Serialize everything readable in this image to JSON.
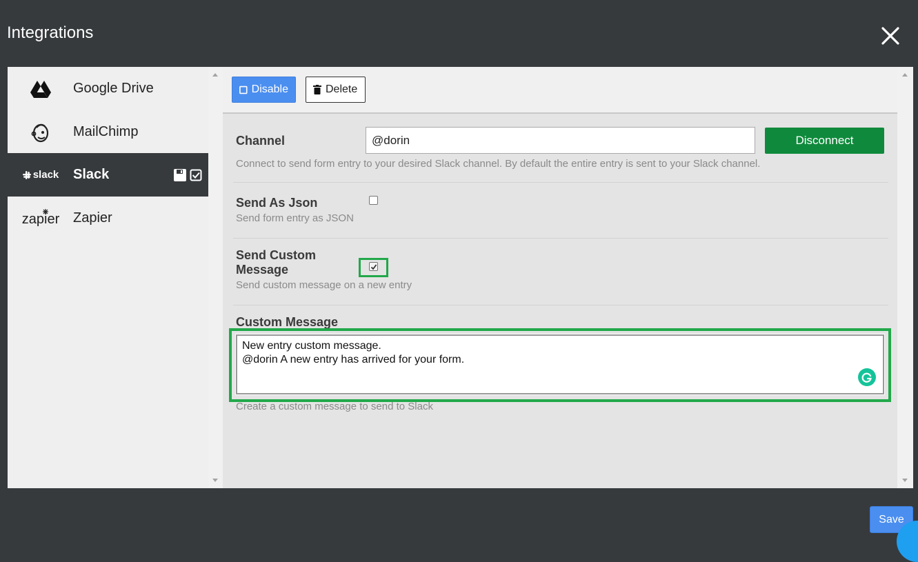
{
  "window": {
    "title": "Integrations"
  },
  "sidebar": {
    "items": [
      {
        "label": "Google Drive",
        "icon": "google-drive-icon"
      },
      {
        "label": "MailChimp",
        "icon": "mailchimp-icon"
      },
      {
        "label": "Slack",
        "icon": "slack-icon",
        "logo_text": "slack",
        "active": true
      },
      {
        "label": "Zapier",
        "icon": "zapier-icon",
        "logo_text": "zapier"
      }
    ]
  },
  "toolbar": {
    "disable_label": "Disable",
    "delete_label": "Delete"
  },
  "form": {
    "channel": {
      "label": "Channel",
      "value": "@dorin",
      "button": "Disconnect",
      "help": "Connect to send form entry to your desired Slack channel. By default the entire entry is sent to your Slack channel."
    },
    "send_json": {
      "label": "Send As Json",
      "help": "Send form entry as JSON",
      "checked": false
    },
    "send_custom": {
      "label_line1": "Send Custom",
      "label_line2": "Message",
      "help": "Send custom message on a new entry",
      "checked": true
    },
    "custom_message": {
      "label": "Custom Message",
      "value": "New entry custom message.\n@dorin A new entry has arrived for your form.",
      "help": "Create a custom message to send to Slack"
    }
  },
  "footer": {
    "save_label": "Save"
  },
  "colors": {
    "accent_blue": "#4a8ef0",
    "disconnect_green": "#0f8a3c",
    "highlight_green": "#22a84a",
    "dark_bg": "#363a3d"
  }
}
